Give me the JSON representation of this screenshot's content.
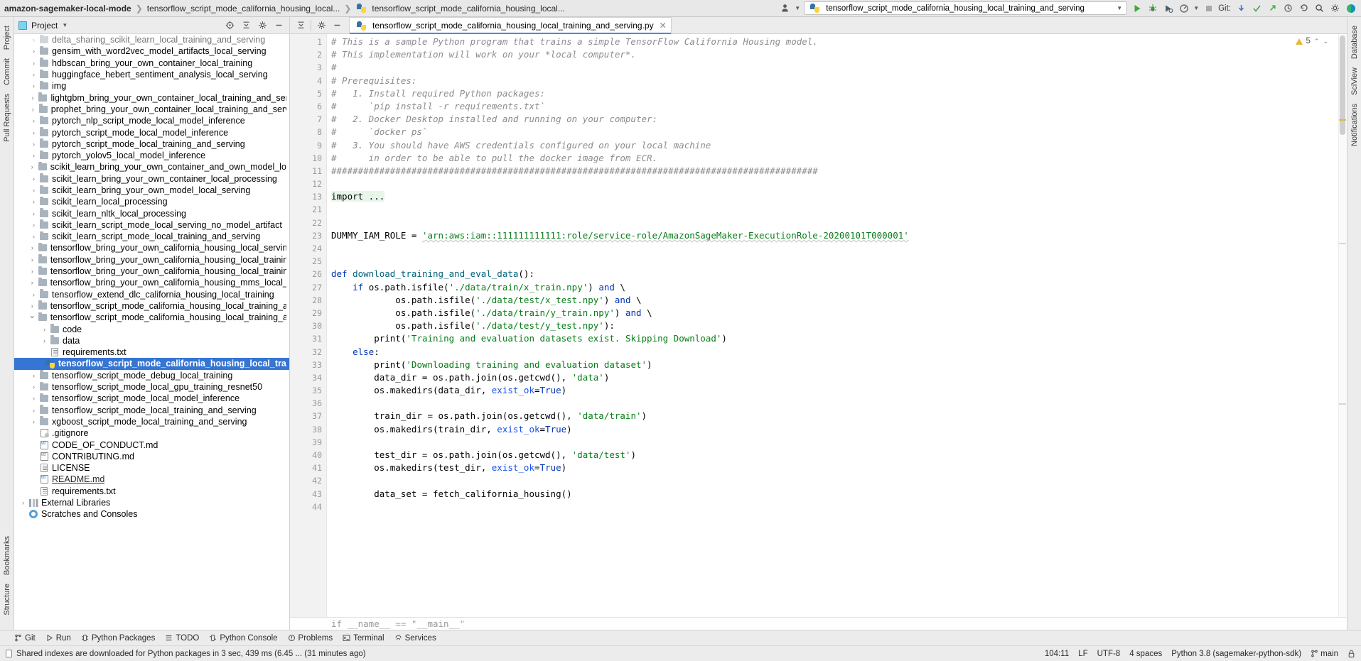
{
  "topbar": {
    "breadcrumbs": [
      {
        "label": "amazon-sagemaker-local-mode",
        "bold": true
      },
      {
        "label": "tensorflow_script_mode_california_housing_local...",
        "bold": false
      },
      {
        "label": "tensorflow_script_mode_california_housing_local...",
        "bold": false
      }
    ],
    "run_config": "tensorflow_script_mode_california_housing_local_training_and_serving",
    "git_label": "Git:",
    "icons": [
      "profiler-icon",
      "run-icon",
      "debug-icon",
      "run-coverage-icon",
      "profile-icon",
      "stop-icon",
      "update-project-icon",
      "commit-icon",
      "push-icon",
      "history-icon",
      "rollback-icon",
      "search-everywhere-icon",
      "settings-icon",
      "account-icon"
    ]
  },
  "left_rail": {
    "tabs": [
      "Project",
      "Commit",
      "Pull Requests",
      "Bookmarks",
      "Structure"
    ]
  },
  "right_rail": {
    "tabs": [
      "Database",
      "SciView",
      "Notifications"
    ]
  },
  "project_panel": {
    "title": "Project",
    "toolbar_icons": [
      "locate-icon",
      "collapse-all-icon",
      "settings-icon",
      "hide-icon"
    ],
    "tree": [
      {
        "depth": 1,
        "label": "delta_sharing_scikit_learn_local_training_and_serving",
        "icon": "folder",
        "arrow": "right",
        "clipped": true,
        "faded": true
      },
      {
        "depth": 1,
        "label": "gensim_with_word2vec_model_artifacts_local_serving",
        "icon": "folder",
        "arrow": "right"
      },
      {
        "depth": 1,
        "label": "hdbscan_bring_your_own_container_local_training",
        "icon": "folder",
        "arrow": "right"
      },
      {
        "depth": 1,
        "label": "huggingface_hebert_sentiment_analysis_local_serving",
        "icon": "folder",
        "arrow": "right"
      },
      {
        "depth": 1,
        "label": "img",
        "icon": "folder",
        "arrow": "right"
      },
      {
        "depth": 1,
        "label": "lightgbm_bring_your_own_container_local_training_and_serving",
        "icon": "folder",
        "arrow": "right"
      },
      {
        "depth": 1,
        "label": "prophet_bring_your_own_container_local_training_and_serving",
        "icon": "folder",
        "arrow": "right"
      },
      {
        "depth": 1,
        "label": "pytorch_nlp_script_mode_local_model_inference",
        "icon": "folder",
        "arrow": "right"
      },
      {
        "depth": 1,
        "label": "pytorch_script_mode_local_model_inference",
        "icon": "folder",
        "arrow": "right"
      },
      {
        "depth": 1,
        "label": "pytorch_script_mode_local_training_and_serving",
        "icon": "folder",
        "arrow": "right"
      },
      {
        "depth": 1,
        "label": "pytorch_yolov5_local_model_inference",
        "icon": "folder",
        "arrow": "right"
      },
      {
        "depth": 1,
        "label": "scikit_learn_bring_your_own_container_and_own_model_local_ser",
        "icon": "folder",
        "arrow": "right"
      },
      {
        "depth": 1,
        "label": "scikit_learn_bring_your_own_container_local_processing",
        "icon": "folder",
        "arrow": "right"
      },
      {
        "depth": 1,
        "label": "scikit_learn_bring_your_own_model_local_serving",
        "icon": "folder",
        "arrow": "right"
      },
      {
        "depth": 1,
        "label": "scikit_learn_local_processing",
        "icon": "folder",
        "arrow": "right"
      },
      {
        "depth": 1,
        "label": "scikit_learn_nltk_local_processing",
        "icon": "folder",
        "arrow": "right"
      },
      {
        "depth": 1,
        "label": "scikit_learn_script_mode_local_serving_no_model_artifact",
        "icon": "folder",
        "arrow": "right"
      },
      {
        "depth": 1,
        "label": "scikit_learn_script_mode_local_training_and_serving",
        "icon": "folder",
        "arrow": "right"
      },
      {
        "depth": 1,
        "label": "tensorflow_bring_your_own_california_housing_local_serving_with",
        "icon": "folder",
        "arrow": "right"
      },
      {
        "depth": 1,
        "label": "tensorflow_bring_your_own_california_housing_local_training_and",
        "icon": "folder",
        "arrow": "right"
      },
      {
        "depth": 1,
        "label": "tensorflow_bring_your_own_california_housing_local_training_and",
        "icon": "folder",
        "arrow": "right"
      },
      {
        "depth": 1,
        "label": "tensorflow_bring_your_own_california_housing_mms_local_serving",
        "icon": "folder",
        "arrow": "right"
      },
      {
        "depth": 1,
        "label": "tensorflow_extend_dlc_california_housing_local_training",
        "icon": "folder",
        "arrow": "right"
      },
      {
        "depth": 1,
        "label": "tensorflow_script_mode_california_housing_local_training_and_bat",
        "icon": "folder",
        "arrow": "right"
      },
      {
        "depth": 1,
        "label": "tensorflow_script_mode_california_housing_local_training_and_ser",
        "icon": "folder",
        "arrow": "down"
      },
      {
        "depth": 2,
        "label": "code",
        "icon": "folder",
        "arrow": "right"
      },
      {
        "depth": 2,
        "label": "data",
        "icon": "folder",
        "arrow": "right"
      },
      {
        "depth": 2,
        "label": "requirements.txt",
        "icon": "txt",
        "arrow": "none"
      },
      {
        "depth": 2,
        "label": "tensorflow_script_mode_california_housing_local_training_and_",
        "icon": "python",
        "arrow": "none",
        "selected": true
      },
      {
        "depth": 1,
        "label": "tensorflow_script_mode_debug_local_training",
        "icon": "folder",
        "arrow": "right"
      },
      {
        "depth": 1,
        "label": "tensorflow_script_mode_local_gpu_training_resnet50",
        "icon": "folder",
        "arrow": "right"
      },
      {
        "depth": 1,
        "label": "tensorflow_script_mode_local_model_inference",
        "icon": "folder",
        "arrow": "right"
      },
      {
        "depth": 1,
        "label": "tensorflow_script_mode_local_training_and_serving",
        "icon": "folder",
        "arrow": "right"
      },
      {
        "depth": 1,
        "label": "xgboost_script_mode_local_training_and_serving",
        "icon": "folder",
        "arrow": "right"
      },
      {
        "depth": 1,
        "label": ".gitignore",
        "icon": "gitignore",
        "arrow": "none"
      },
      {
        "depth": 1,
        "label": "CODE_OF_CONDUCT.md",
        "icon": "md",
        "arrow": "none"
      },
      {
        "depth": 1,
        "label": "CONTRIBUTING.md",
        "icon": "md",
        "arrow": "none"
      },
      {
        "depth": 1,
        "label": "LICENSE",
        "icon": "txt",
        "arrow": "none"
      },
      {
        "depth": 1,
        "label": "README.md",
        "icon": "md",
        "arrow": "none",
        "link": true
      },
      {
        "depth": 1,
        "label": "requirements.txt",
        "icon": "txt",
        "arrow": "none"
      },
      {
        "depth": 0,
        "label": "External Libraries",
        "icon": "lib",
        "arrow": "right"
      },
      {
        "depth": 0,
        "label": "Scratches and Consoles",
        "icon": "scratch",
        "arrow": "none"
      }
    ]
  },
  "editor": {
    "toolbar_icons": [
      "expand-icon",
      "settings-icon",
      "hide-icon"
    ],
    "tab": {
      "label": "tensorflow_script_mode_california_housing_local_training_and_serving.py",
      "icon": "python-file-icon",
      "close": "✕"
    },
    "inspection": {
      "warning_count": "5",
      "up": "⌃",
      "down": "⌄"
    },
    "footer_hint": "if __name__ == \"__main__\"",
    "lines": [
      {
        "n": "1",
        "fold": "minus",
        "tokens": [
          {
            "t": "# This is a sample Python program that trains a simple TensorFlow California Housing model.",
            "c": "cm"
          }
        ]
      },
      {
        "n": "2",
        "tokens": [
          {
            "t": "# This implementation will work on your *local computer*.",
            "c": "cm"
          }
        ]
      },
      {
        "n": "3",
        "tokens": [
          {
            "t": "#",
            "c": "cm"
          }
        ]
      },
      {
        "n": "4",
        "tokens": [
          {
            "t": "# Prerequisites:",
            "c": "cm"
          }
        ]
      },
      {
        "n": "5",
        "tokens": [
          {
            "t": "#   1. Install required Python packages:",
            "c": "cm"
          }
        ]
      },
      {
        "n": "6",
        "tokens": [
          {
            "t": "#      `pip install -r requirements.txt`",
            "c": "cm"
          }
        ]
      },
      {
        "n": "7",
        "tokens": [
          {
            "t": "#   2. Docker Desktop installed and running on your computer:",
            "c": "cm"
          }
        ]
      },
      {
        "n": "8",
        "tokens": [
          {
            "t": "#      `docker ps`",
            "c": "cm"
          }
        ]
      },
      {
        "n": "9",
        "tokens": [
          {
            "t": "#   3. You should have AWS credentials configured on your local machine",
            "c": "cm"
          }
        ]
      },
      {
        "n": "10",
        "tokens": [
          {
            "t": "#      in order to be able to pull the docker image from ECR.",
            "c": "cm"
          }
        ]
      },
      {
        "n": "11",
        "fold": "minus",
        "tokens": [
          {
            "t": "###########################################################################################",
            "c": "cm"
          }
        ]
      },
      {
        "n": "12",
        "tokens": []
      },
      {
        "n": "13",
        "fold": "plus",
        "tokens": [
          {
            "t": "import ...",
            "c": "hl-import"
          }
        ]
      },
      {
        "n": "21",
        "tokens": []
      },
      {
        "n": "22",
        "tokens": []
      },
      {
        "n": "23",
        "tokens": [
          {
            "t": "DUMMY_IAM_ROLE",
            "c": "id"
          },
          {
            "t": " = ",
            "c": "id"
          },
          {
            "t": "'arn:aws:iam::111111111111:role/service-role/AmazonSageMaker-ExecutionRole-20200101T000001'",
            "c": "st"
          }
        ]
      },
      {
        "n": "24",
        "tokens": []
      },
      {
        "n": "25",
        "tokens": []
      },
      {
        "n": "26",
        "fold": "minus",
        "tokens": [
          {
            "t": "def ",
            "c": "kw"
          },
          {
            "t": "download_training_and_eval_data",
            "c": "fn"
          },
          {
            "t": "():",
            "c": "id"
          }
        ]
      },
      {
        "n": "27",
        "tokens": [
          {
            "t": "    ",
            "c": "id"
          },
          {
            "t": "if ",
            "c": "kw"
          },
          {
            "t": "os.path.isfile(",
            "c": "id"
          },
          {
            "t": "'./data/train/x_train.npy'",
            "c": "st"
          },
          {
            "t": ") ",
            "c": "id"
          },
          {
            "t": "and ",
            "c": "kw"
          },
          {
            "t": "\\",
            "c": "id"
          }
        ]
      },
      {
        "n": "28",
        "tokens": [
          {
            "t": "            os.path.isfile(",
            "c": "id"
          },
          {
            "t": "'./data/test/x_test.npy'",
            "c": "st"
          },
          {
            "t": ") ",
            "c": "id"
          },
          {
            "t": "and ",
            "c": "kw"
          },
          {
            "t": "\\",
            "c": "id"
          }
        ]
      },
      {
        "n": "29",
        "tokens": [
          {
            "t": "            os.path.isfile(",
            "c": "id"
          },
          {
            "t": "'./data/train/y_train.npy'",
            "c": "st"
          },
          {
            "t": ") ",
            "c": "id"
          },
          {
            "t": "and ",
            "c": "kw"
          },
          {
            "t": "\\",
            "c": "id"
          }
        ]
      },
      {
        "n": "30",
        "tokens": [
          {
            "t": "            os.path.isfile(",
            "c": "id"
          },
          {
            "t": "'./data/test/y_test.npy'",
            "c": "st"
          },
          {
            "t": "):",
            "c": "id"
          }
        ]
      },
      {
        "n": "31",
        "tokens": [
          {
            "t": "        ",
            "c": "id"
          },
          {
            "t": "print",
            "c": "id"
          },
          {
            "t": "(",
            "c": "id"
          },
          {
            "t": "'Training and evaluation datasets exist. Skipping Download'",
            "c": "st"
          },
          {
            "t": ")",
            "c": "id"
          }
        ]
      },
      {
        "n": "32",
        "fold": "minus2",
        "tokens": [
          {
            "t": "    ",
            "c": "id"
          },
          {
            "t": "else",
            "c": "kw"
          },
          {
            "t": ":",
            "c": "id"
          }
        ]
      },
      {
        "n": "33",
        "tokens": [
          {
            "t": "        ",
            "c": "id"
          },
          {
            "t": "print",
            "c": "id"
          },
          {
            "t": "(",
            "c": "id"
          },
          {
            "t": "'Downloading training and evaluation dataset'",
            "c": "st"
          },
          {
            "t": ")",
            "c": "id"
          }
        ]
      },
      {
        "n": "34",
        "tokens": [
          {
            "t": "        data_dir = os.path.join(os.getcwd(), ",
            "c": "id"
          },
          {
            "t": "'data'",
            "c": "st"
          },
          {
            "t": ")",
            "c": "id"
          }
        ]
      },
      {
        "n": "35",
        "tokens": [
          {
            "t": "        os.makedirs(data_dir, ",
            "c": "id"
          },
          {
            "t": "exist_ok",
            "c": "nm"
          },
          {
            "t": "=",
            "c": "id"
          },
          {
            "t": "True",
            "c": "kw"
          },
          {
            "t": ")",
            "c": "id"
          }
        ]
      },
      {
        "n": "36",
        "tokens": []
      },
      {
        "n": "37",
        "tokens": [
          {
            "t": "        train_dir = os.path.join(os.getcwd(), ",
            "c": "id"
          },
          {
            "t": "'data/train'",
            "c": "st"
          },
          {
            "t": ")",
            "c": "id"
          }
        ]
      },
      {
        "n": "38",
        "tokens": [
          {
            "t": "        os.makedirs(train_dir, ",
            "c": "id"
          },
          {
            "t": "exist_ok",
            "c": "nm"
          },
          {
            "t": "=",
            "c": "id"
          },
          {
            "t": "True",
            "c": "kw"
          },
          {
            "t": ")",
            "c": "id"
          }
        ]
      },
      {
        "n": "39",
        "tokens": []
      },
      {
        "n": "40",
        "tokens": [
          {
            "t": "        test_dir = os.path.join(os.getcwd(), ",
            "c": "id"
          },
          {
            "t": "'data/test'",
            "c": "st"
          },
          {
            "t": ")",
            "c": "id"
          }
        ]
      },
      {
        "n": "41",
        "tokens": [
          {
            "t": "        os.makedirs(test_dir, ",
            "c": "id"
          },
          {
            "t": "exist_ok",
            "c": "nm"
          },
          {
            "t": "=",
            "c": "id"
          },
          {
            "t": "True",
            "c": "kw"
          },
          {
            "t": ")",
            "c": "id"
          }
        ]
      },
      {
        "n": "42",
        "tokens": []
      },
      {
        "n": "43",
        "tokens": [
          {
            "t": "        data_set = fetch_california_housing()",
            "c": "id"
          }
        ]
      },
      {
        "n": "44",
        "tokens": []
      }
    ]
  },
  "tool_window_bar": {
    "items": [
      {
        "label": "Git",
        "icon": "git-icon"
      },
      {
        "label": "Run",
        "icon": "run-icon"
      },
      {
        "label": "Python Packages",
        "icon": "python-packages-icon"
      },
      {
        "label": "TODO",
        "icon": "todo-icon"
      },
      {
        "label": "Python Console",
        "icon": "python-console-icon"
      },
      {
        "label": "Problems",
        "icon": "problems-icon"
      },
      {
        "label": "Terminal",
        "icon": "terminal-icon"
      },
      {
        "label": "Services",
        "icon": "services-icon"
      }
    ]
  },
  "status_bar": {
    "message": "Shared indexes are downloaded for Python packages in 3 sec, 439 ms (6.45 ... (31 minutes ago)",
    "caret": "104:11",
    "line_sep": "LF",
    "encoding": "UTF-8",
    "indent": "4 spaces",
    "interpreter": "Python 3.8 (sagemaker-python-sdk)",
    "branch": "main",
    "lock": "lock-icon"
  },
  "colors": {
    "accent": "#3675d3",
    "tab_underline": "#4a89dc",
    "string": "#067d17",
    "keyword": "#0033b3",
    "comment": "#8c8c8c",
    "warning": "#e8b931"
  }
}
